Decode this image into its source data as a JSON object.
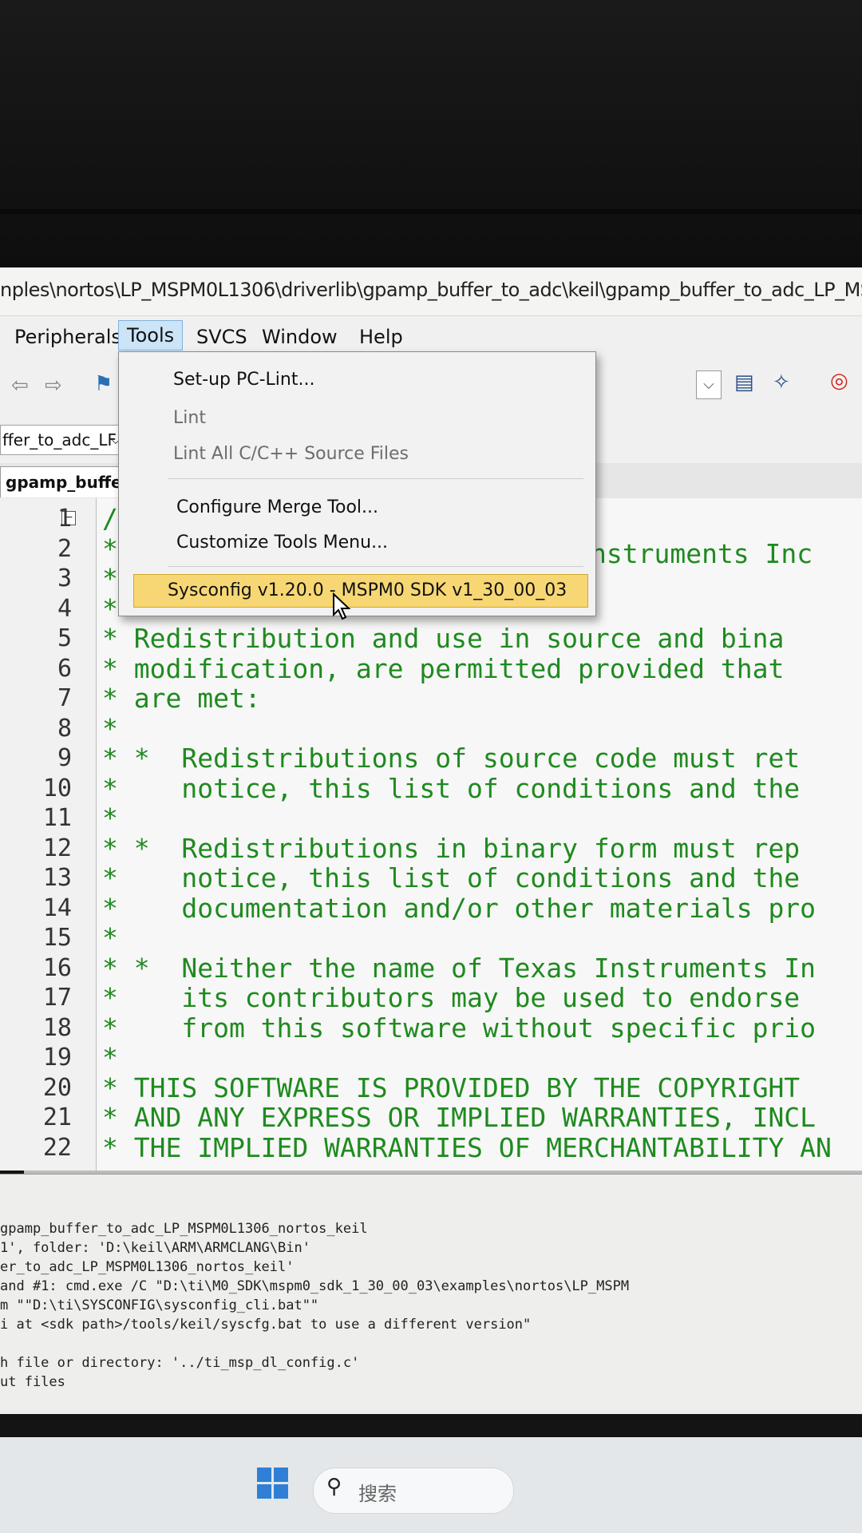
{
  "window": {
    "title": "nples\\nortos\\LP_MSPM0L1306\\driverlib\\gpamp_buffer_to_adc\\keil\\gpamp_buffer_to_adc_LP_MSI"
  },
  "menubar": {
    "items": [
      "Peripherals",
      "Tools",
      "SVCS",
      "Window",
      "Help"
    ],
    "active": "Tools"
  },
  "toolbar": {
    "target_combo": "ffer_to_adc_LF"
  },
  "editor_tab": {
    "label": "gpamp_buffer_"
  },
  "tools_menu": {
    "items": [
      {
        "label": "Set-up PC-Lint...",
        "enabled": true
      },
      {
        "label": "Lint",
        "enabled": false
      },
      {
        "label": "Lint All C/C++ Source Files",
        "enabled": false
      },
      {
        "label": "Configure Merge Tool...",
        "enabled": true
      },
      {
        "label": "Customize Tools Menu...",
        "enabled": true
      },
      {
        "label": "Sysconfig v1.20.0 - MSPM0 SDK v1_30_00_03",
        "enabled": true,
        "highlighted": true
      }
    ]
  },
  "code": {
    "line_numbers": [
      "1",
      "2",
      "3",
      "4",
      "5",
      "6",
      "7",
      "8",
      "9",
      "10",
      "11",
      "12",
      "13",
      "14",
      "15",
      "16",
      "17",
      "18",
      "19",
      "20",
      "21",
      "22"
    ],
    "lines": [
      "/*",
      "* ",
      "* ",
      "* ",
      "* Redistribution and use in source and bina",
      "* modification, are permitted provided that",
      "* are met:",
      "*",
      "* *  Redistributions of source code must ret",
      "*    notice, this list of conditions and the",
      "*",
      "* *  Redistributions in binary form must rep",
      "*    notice, this list of conditions and the",
      "*    documentation and/or other materials pro",
      "*",
      "* *  Neither the name of Texas Instruments In",
      "*    its contributors may be used to endorse",
      "*    from this software without specific prio",
      "*",
      "* THIS SOFTWARE IS PROVIDED BY THE COPYRIGHT",
      "* AND ANY EXPRESS OR IMPLIED WARRANTIES, INCL",
      "* THE IMPLIED WARRANTIES OF MERCHANTABILITY AN"
    ],
    "line2_tail": "nstruments Inc"
  },
  "build_output": {
    "lines": [
      "gpamp_buffer_to_adc_LP_MSPM0L1306_nortos_keil",
      "1', folder: 'D:\\keil\\ARM\\ARMCLANG\\Bin'",
      "er_to_adc_LP_MSPM0L1306_nortos_keil'",
      "and #1: cmd.exe /C \"D:\\ti\\M0_SDK\\mspm0_sdk_1_30_00_03\\examples\\nortos\\LP_MSPM",
      "m \"\"D:\\ti\\SYSCONFIG\\sysconfig_cli.bat\"\"",
      "i at <sdk path>/tools/keil/syscfg.bat to use a different version\"",
      "",
      "h file or directory: '../ti_msp_dl_config.c'",
      "ut files"
    ]
  },
  "taskbar": {
    "search_placeholder": "搜索"
  },
  "colors": {
    "code_comment": "#1f8a1f",
    "menu_highlight": "#f7d774",
    "active_menu": "#cce4f7"
  }
}
